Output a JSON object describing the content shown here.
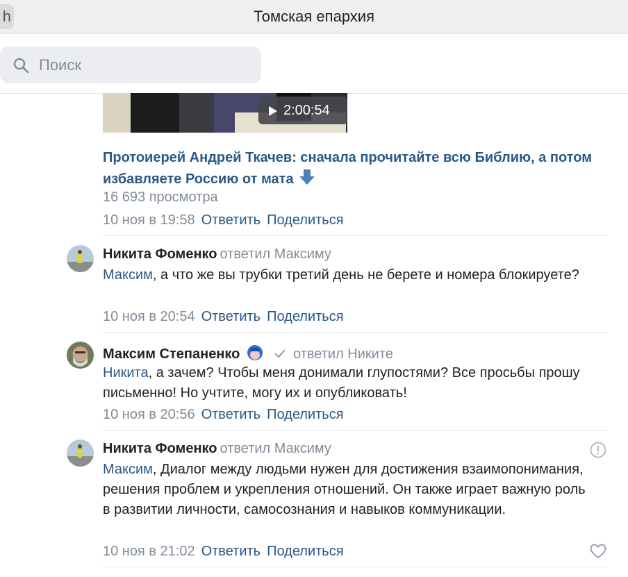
{
  "window": {
    "title": "Томская епархия",
    "back_label": "h"
  },
  "search": {
    "placeholder": "Поиск"
  },
  "post": {
    "video": {
      "duration": "2:00:54"
    },
    "title": "Протоиерей Андрей Ткачев: сначала прочитайте всю Библию, а потом избавляете Россию от мата",
    "views": "16 693 просмотра",
    "date": "10 ноя в 19:58",
    "reply_label": "Ответить",
    "share_label": "Поделиться"
  },
  "comments": [
    {
      "author": "Никита Фоменко",
      "reply_to": "ответил Максиму",
      "mention": "Максим",
      "text": ", а что же вы трубки третий день не берете и номера блокируете?",
      "date": "10 ноя в 20:54",
      "reply_label": "Ответить",
      "share_label": "Поделиться"
    },
    {
      "author": "Максим Степаненко",
      "reply_to": "ответил Никите",
      "mention": "Никита",
      "text": ", а зачем? Чтобы меня донимали глупостями? Все просьбы прошу письменно! Но учтите, могу их и опубликовать!",
      "date": "10 ноя в 20:56",
      "reply_label": "Ответить",
      "share_label": "Поделиться"
    },
    {
      "author": "Никита Фоменко",
      "reply_to": "ответил Максиму",
      "mention": "Максим",
      "text": ", Диалог между людьми нужен для достижения взаимопонимания, решения проблем и укрепления отношений. Он также играет важную роль в развитии личности, самосознания и навыков коммуникации.",
      "date": "10 ноя в 21:02",
      "reply_label": "Ответить",
      "share_label": "Поделиться"
    }
  ],
  "colors": {
    "link": "#2a5885",
    "muted": "#818c99",
    "text": "#222222",
    "search_bg": "#ebedf0"
  },
  "icons": [
    "search-icon",
    "play-icon",
    "arrow-down-icon",
    "verified-check-icon",
    "report-icon",
    "like-heart-icon"
  ]
}
